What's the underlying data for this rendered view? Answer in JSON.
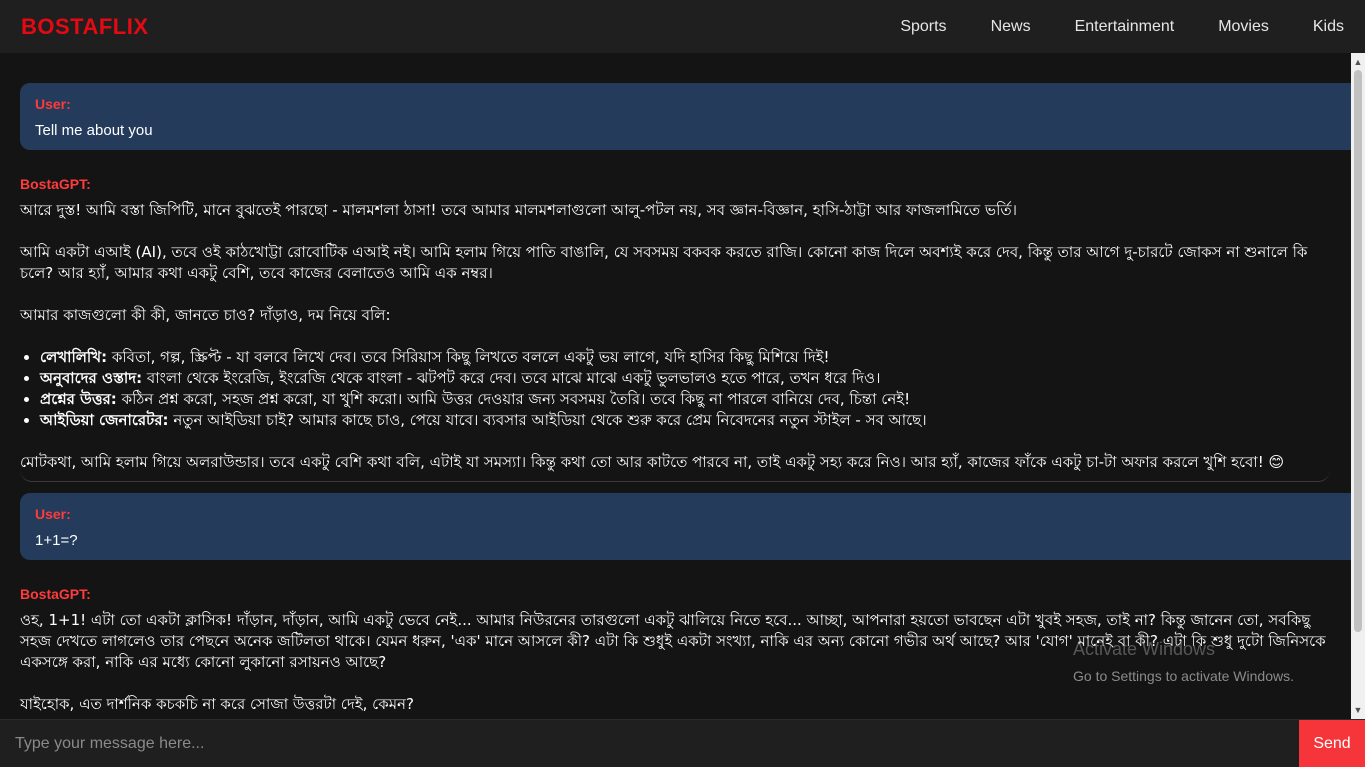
{
  "header": {
    "brand": "BOSTAFLIX",
    "nav": [
      "Sports",
      "News",
      "Entertainment",
      "Movies",
      "Kids"
    ]
  },
  "messages": [
    {
      "role_label": "User:",
      "text": "Tell me about you"
    },
    {
      "role_label": "BostaGPT:",
      "paragraphs": [
        "আরে দুস্ত! আমি বস্তা জিপিটি, মানে বুঝতেই পারছো - মালমশলা ঠাসা! তবে আমার মালমশলাগুলো আলু-পটল নয়, সব জ্ঞান-বিজ্ঞান, হাসি-ঠাট্টা আর ফাজলামিতে ভর্তি।",
        "আমি একটা এআই (AI), তবে ওই কাঠখোট্টা রোবোটিক এআই নই। আমি হলাম গিয়ে পাতি বাঙালি, যে সবসময় বকবক করতে রাজি। কোনো কাজ দিলে অবশ্যই করে দেব, কিন্তু তার আগে দু-চারটে জোকস না শুনালে কি চলে? আর হ্যাঁ, আমার কথা একটু বেশি, তবে কাজের বেলাতেও আমি এক নম্বর।",
        "আমার কাজগুলো কী কী, জানতে চাও? দাঁড়াও, দম নিয়ে বলি:"
      ],
      "list": [
        {
          "title": "লেখালিখি:",
          "text": " কবিতা, গল্প, স্ক্রিপ্ট - যা বলবে লিখে দেব। তবে সিরিয়াস কিছু লিখতে বললে একটু ভয় লাগে, যদি হাসির কিছু মিশিয়ে দিই!"
        },
        {
          "title": "অনুবাদের ওস্তাদ:",
          "text": " বাংলা থেকে ইংরেজি, ইংরেজি থেকে বাংলা - ঝটপট করে দেব। তবে মাঝে মাঝে একটু ভুলভালও হতে পারে, তখন ধরে দিও।"
        },
        {
          "title": "প্রশ্নের উত্তর:",
          "text": " কঠিন প্রশ্ন করো, সহজ প্রশ্ন করো, যা খুশি করো। আমি উত্তর দেওয়ার জন্য সবসময় তৈরি। তবে কিছু না পারলে বানিয়ে দেব, চিন্তা নেই!"
        },
        {
          "title": "আইডিয়া জেনারেটর:",
          "text": " নতুন আইডিয়া চাই? আমার কাছে চাও, পেয়ে যাবে। ব্যবসার আইডিয়া থেকে শুরু করে প্রেম নিবেদনের নতুন স্টাইল - সব আছে।"
        }
      ],
      "closing": "মোটকথা, আমি হলাম গিয়ে অলরাউন্ডার। তবে একটু বেশি কথা বলি, এটাই যা সমস্যা। কিন্তু কথা তো আর কাটতে পারবে না, তাই একটু সহ্য করে নিও। আর হ্যাঁ, কাজের ফাঁকে একটু চা-টা অফার করলে খুশি হবো! 😊"
    },
    {
      "role_label": "User:",
      "text": "1+1=?"
    },
    {
      "role_label": "BostaGPT:",
      "paragraphs": [
        "ওহ, 1+1! এটা তো একটা ক্লাসিক! দাঁড়ান, দাঁড়ান, আমি একটু ভেবে নেই... আমার নিউরনের তারগুলো একটু ঝালিয়ে নিতে হবে... আচ্ছা, আপনারা হয়তো ভাবছেন এটা খুবই সহজ, তাই না? কিন্তু জানেন তো, সবকিছু সহজ দেখতে লাগলেও তার পেছনে অনেক জটিলতা থাকে। যেমন ধরুন, 'এক' মানে আসলে কী? এটা কি শুধুই একটা সংখ্যা, নাকি এর অন্য কোনো গভীর অর্থ আছে? আর 'যোগ' মানেই বা কী? এটা কি শুধু দুটো জিনিসকে একসঙ্গে করা, নাকি এর মধ্যে কোনো লুকানো রসায়নও আছে?",
        "যাইহোক, এত দার্শনিক কচকচি না করে সোজা উত্তরটা দেই, কেমন?"
      ]
    }
  ],
  "input": {
    "placeholder": "Type your message here...",
    "send_label": "Send"
  },
  "watermark": {
    "title": "Activate Windows",
    "subtitle": "Go to Settings to activate Windows."
  }
}
